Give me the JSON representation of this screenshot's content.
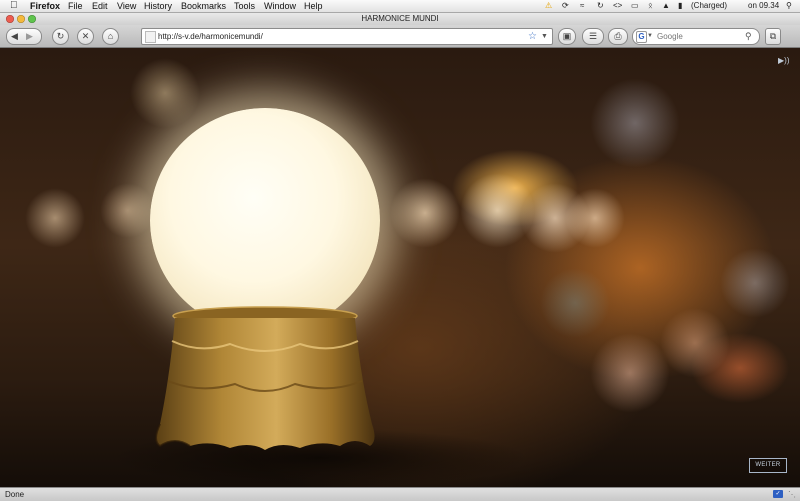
{
  "menubar": {
    "apple_icon": "apple-icon",
    "app_name": "Firefox",
    "menus": [
      "File",
      "Edit",
      "View",
      "History",
      "Bookmarks",
      "Tools",
      "Window",
      "Help"
    ],
    "battery_status": "(Charged)",
    "clock": "on 09.34"
  },
  "window": {
    "title": "HARMONICE MUNDI"
  },
  "toolbar": {
    "url": "http://s-v.de/harmonicemundi/",
    "search_engine": "Google",
    "search_placeholder": "Google"
  },
  "page": {
    "continue_label": "WEITER"
  },
  "statusbar": {
    "text": "Done"
  },
  "colors": {
    "globe_glow": "#fff8e2",
    "base_gold": "#a97c2e",
    "bokeh_orange": "#f0a040",
    "weiter_border": "#a8b6c8"
  }
}
